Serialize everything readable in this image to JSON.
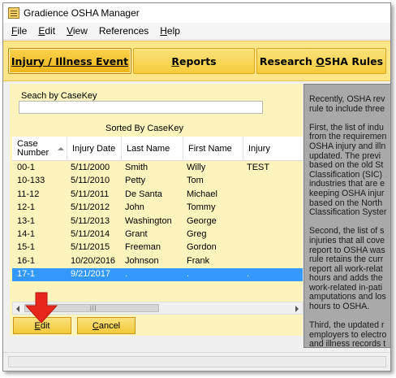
{
  "window": {
    "title": "Gradience OSHA Manager"
  },
  "menu": [
    {
      "key": "F",
      "rest": "ile"
    },
    {
      "key": "E",
      "rest": "dit"
    },
    {
      "key": "V",
      "rest": "iew"
    },
    {
      "key": "",
      "rest": "References"
    },
    {
      "key": "H",
      "rest": "elp"
    }
  ],
  "nav": {
    "injury": "Injury / Illness Event",
    "reports_key": "R",
    "reports_rest": "eports",
    "research_pre": "Research ",
    "research_key": "O",
    "research_rest": "SHA Rules"
  },
  "search": {
    "label": "Seach by CaseKey",
    "value": ""
  },
  "sorted_label": "Sorted By CaseKey",
  "grid": {
    "headers": [
      "Case\nNumber",
      "Injury Date",
      "Last Name",
      "First Name",
      "Injury"
    ],
    "rows": [
      [
        "00-1",
        "5/11/2000",
        "Smith",
        "Willy",
        "TEST"
      ],
      [
        "10-133",
        "5/11/2010",
        "Petty",
        "Tom",
        ""
      ],
      [
        "11-12",
        "5/11/2011",
        "De Santa",
        "Michael",
        ""
      ],
      [
        "12-1",
        "5/11/2012",
        "John",
        "Tommy",
        ""
      ],
      [
        "13-1",
        "5/11/2013",
        "Washington",
        "George",
        ""
      ],
      [
        "14-1",
        "5/11/2014",
        "Grant",
        "Greg",
        ""
      ],
      [
        "15-1",
        "5/11/2015",
        "Freeman",
        "Gordon",
        ""
      ],
      [
        "16-1",
        "10/20/2016",
        "Johnson",
        "Frank",
        ""
      ],
      [
        "17-1",
        "9/21/2017",
        ".",
        ".",
        "."
      ]
    ],
    "selected_row": 8
  },
  "buttons": {
    "edit_key": "E",
    "edit_rest": "dit",
    "cancel_key": "C",
    "cancel_rest": "ancel"
  },
  "right_panel": {
    "paragraphs": [
      [
        "Recently, OSHA rev",
        "rule to include three"
      ],
      [
        "First, the list of indu",
        "from the requiremen",
        "OSHA injury and illn",
        "updated.  The previ",
        "based on the old St",
        "Classification (SIC)",
        "industries that are e",
        "keeping OSHA injur",
        "based on the North",
        "Classification Syster"
      ],
      [
        "Second, the list of s",
        "injuries that all cove",
        "report to OSHA was",
        "rule retains the curr",
        "report all work-relat",
        "hours and adds the",
        "work-related in-pati",
        "amputations and los",
        "hours to OSHA."
      ],
      [
        "Third, the updated r",
        "employers to electro",
        "and illness records t"
      ]
    ]
  },
  "colors": {
    "nav_band": "#fde58a",
    "panel": "#fdf3bd",
    "selection": "#3399ff",
    "arrow": "#e8261b"
  }
}
